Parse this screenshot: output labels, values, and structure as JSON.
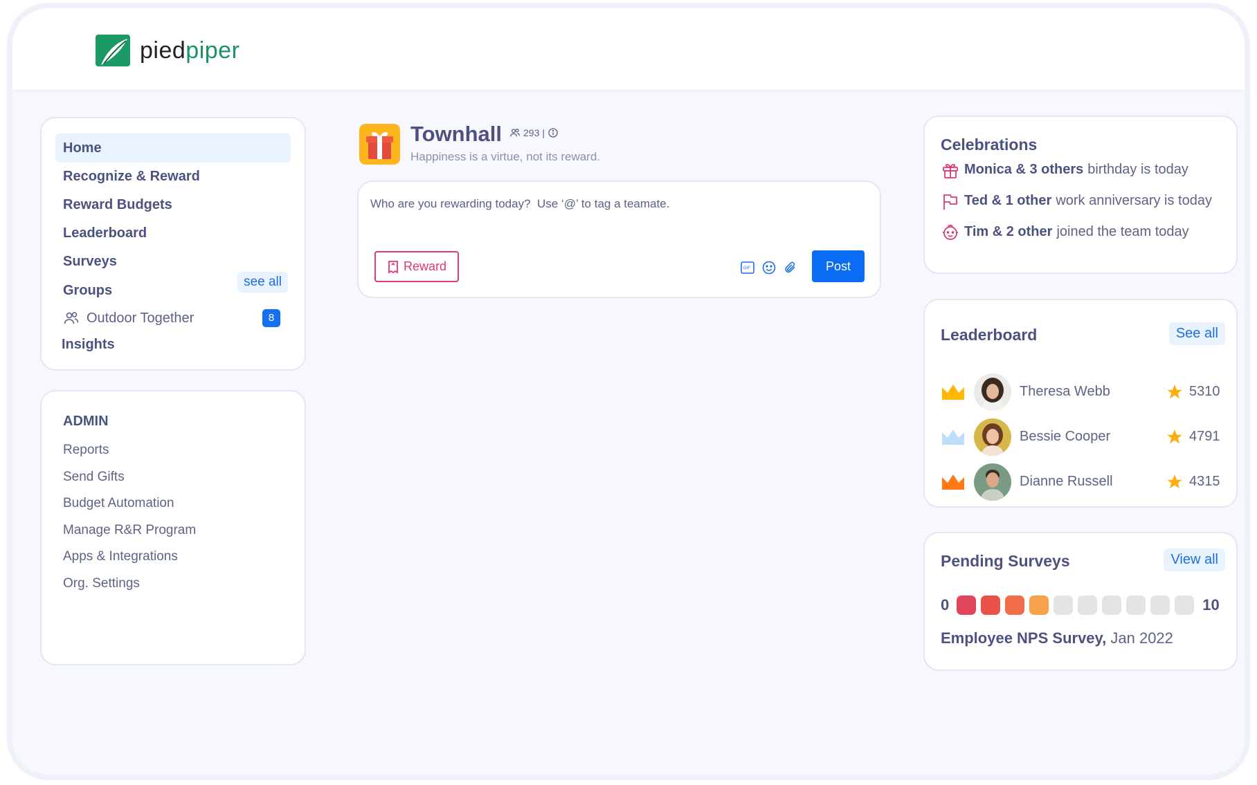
{
  "brand": {
    "name_part1": "pied",
    "name_part2": "piper",
    "color": "#179461"
  },
  "nav": {
    "items": [
      {
        "label": "Home",
        "active": true
      },
      {
        "label": "Recognize & Reward"
      },
      {
        "label": "Reward Budgets"
      },
      {
        "label": "Leaderboard"
      },
      {
        "label": "Surveys"
      }
    ],
    "groups_label": "Groups",
    "see_all": "see all",
    "group": {
      "name": "Outdoor Together",
      "count": "8",
      "icon": "users-icon"
    },
    "insights": "Insights"
  },
  "admin": {
    "title": "ADMIN",
    "links": [
      "Reports",
      "Send Gifts",
      "Budget Automation",
      "Manage R&R Program",
      "Apps & Integrations",
      "Org. Settings"
    ]
  },
  "townhall": {
    "title": "Townhall",
    "members": "293",
    "subtitle": "Happiness is a virtue, not its reward.",
    "icon": "gift-icon"
  },
  "composer": {
    "placeholder": "Who are you rewarding today?  Use ‘@’ to tag a teamate.",
    "reward_label": "Reward",
    "post_label": "Post",
    "tools": [
      "gif-icon",
      "emoji-icon",
      "attach-icon"
    ]
  },
  "celebrations": {
    "title": "Celebrations",
    "items": [
      {
        "icon": "gift-icon",
        "bold": "Monica & 3 others",
        "rest": "birthday is today"
      },
      {
        "icon": "flag-icon",
        "bold": "Ted & 1 other",
        "rest": "work anniversary is today"
      },
      {
        "icon": "baby-icon",
        "bold": "Tim & 2 other",
        "rest": "joined the team today"
      }
    ]
  },
  "leaderboard": {
    "title": "Leaderboard",
    "see_all": "See all",
    "rows": [
      {
        "name": "Theresa Webb",
        "points": "5310",
        "crown_color": "#ffb800"
      },
      {
        "name": "Bessie Cooper",
        "points": "4791",
        "crown_color": "#bfdcfb"
      },
      {
        "name": "Dianne Russell",
        "points": "4315",
        "crown_color": "#ff7a12"
      }
    ]
  },
  "surveys": {
    "title": "Pending Surveys",
    "view_all": "View all",
    "scale_min": "0",
    "scale_max": "10",
    "dot_colors": [
      "#e0455c",
      "#ea5148",
      "#f26d49",
      "#f7a24a",
      "#e4e4e6",
      "#e4e4e6",
      "#e4e4e6",
      "#e4e4e6",
      "#e4e4e6",
      "#e4e4e6"
    ],
    "survey_bold": "Employee NPS Survey,",
    "survey_date": "Jan 2022"
  }
}
